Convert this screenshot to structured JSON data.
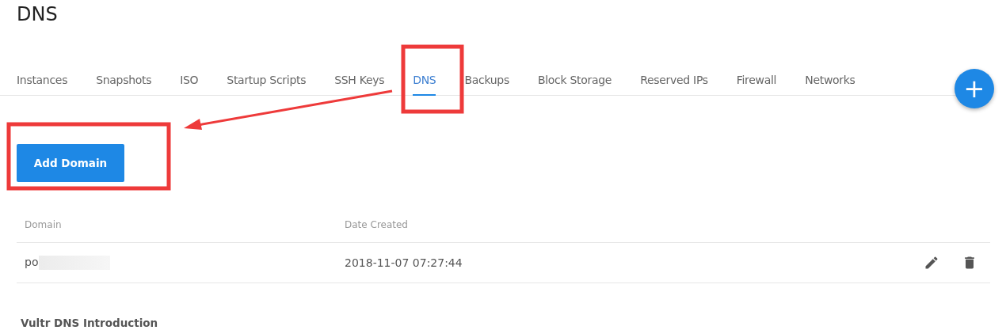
{
  "page_title": "DNS",
  "tabs": [
    {
      "label": "Instances",
      "selected": false
    },
    {
      "label": "Snapshots",
      "selected": false
    },
    {
      "label": "ISO",
      "selected": false
    },
    {
      "label": "Startup Scripts",
      "selected": false
    },
    {
      "label": "SSH Keys",
      "selected": false
    },
    {
      "label": "DNS",
      "selected": true
    },
    {
      "label": "Backups",
      "selected": false
    },
    {
      "label": "Block Storage",
      "selected": false
    },
    {
      "label": "Reserved IPs",
      "selected": false
    },
    {
      "label": "Firewall",
      "selected": false
    },
    {
      "label": "Networks",
      "selected": false
    }
  ],
  "fab": {
    "label": "+"
  },
  "add_button": "Add Domain",
  "table": {
    "columns": [
      "Domain",
      "Date Created"
    ],
    "rows": [
      {
        "domain": "po",
        "date_created": "2018-11-07 07:27:44"
      }
    ]
  },
  "section_heading": "Vultr DNS Introduction"
}
